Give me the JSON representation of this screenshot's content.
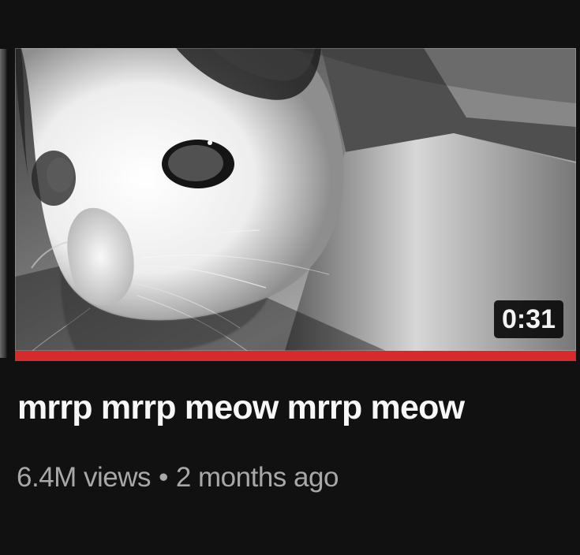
{
  "video": {
    "title": "mrrp mrrp meow mrrp meow",
    "duration": "0:31",
    "views": "6.4M views",
    "separator": "•",
    "age": "2 months ago",
    "progress": 1.0
  },
  "colors": {
    "background": "#0f0f0f",
    "progress_accent": "#d72b2b",
    "title_text": "#f7f7f7",
    "meta_text": "#a8a8a8"
  },
  "thumbnail": {
    "subject_icon": "cat-photo-icon"
  }
}
